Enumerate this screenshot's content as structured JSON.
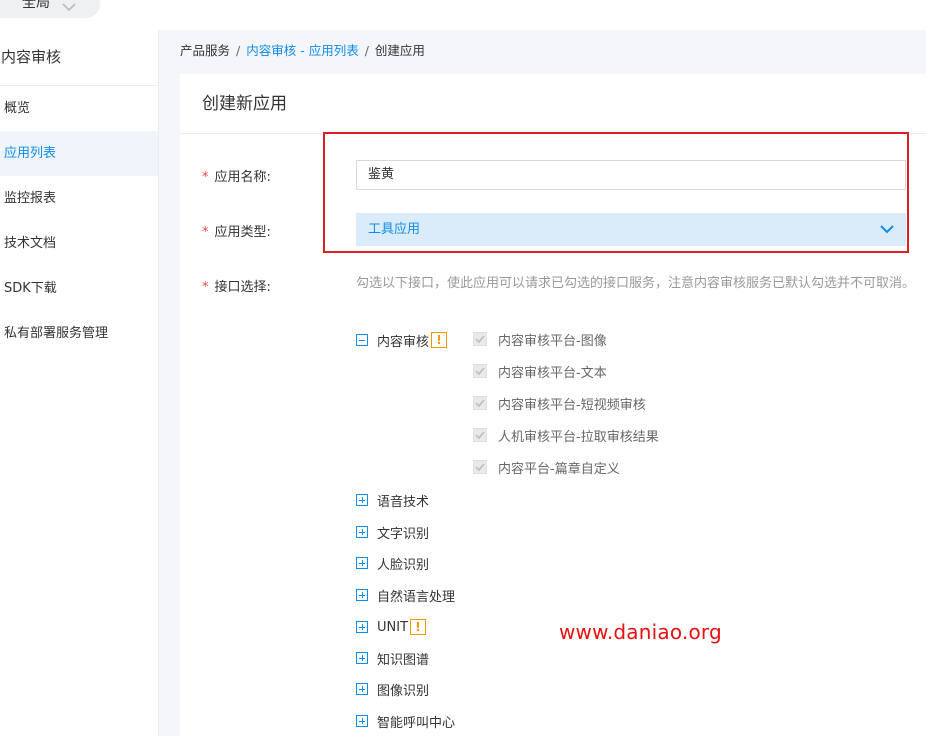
{
  "topbar": {
    "region_label": "全局"
  },
  "sidebar": {
    "title": "内容审核",
    "items": [
      {
        "label": "概览"
      },
      {
        "label": "应用列表",
        "active": true
      },
      {
        "label": "监控报表"
      },
      {
        "label": "技术文档"
      },
      {
        "label": "SDK下载"
      },
      {
        "label": "私有部署服务管理"
      }
    ]
  },
  "breadcrumb": {
    "root": "产品服务",
    "sep": "/",
    "parent": "内容审核 - 应用列表",
    "current": "创建应用"
  },
  "card": {
    "title": "创建新应用"
  },
  "form": {
    "required_mark": "*",
    "name_label": "应用名称:",
    "name_value": "鉴黄",
    "type_label": "应用类型:",
    "type_value": "工具应用",
    "api_label": "接口选择:",
    "api_hint": "勾选以下接口，使此应用可以请求已勾选的接口服务，注意内容审核服务已默认勾选并不可取消。"
  },
  "tree": {
    "expanded_group": {
      "label": "内容审核",
      "warn": "!",
      "children": [
        "内容审核平台-图像",
        "内容审核平台-文本",
        "内容审核平台-短视频审核",
        "人机审核平台-拉取审核结果",
        "内容平台-篇章自定义"
      ]
    },
    "groups": [
      {
        "label": "语音技术"
      },
      {
        "label": "文字识别"
      },
      {
        "label": "人脸识别"
      },
      {
        "label": "自然语言处理"
      },
      {
        "label": "UNIT",
        "warn": "!"
      },
      {
        "label": "知识图谱"
      },
      {
        "label": "图像识别"
      },
      {
        "label": "智能呼叫中心"
      }
    ]
  },
  "watermark": "www.daniao.org",
  "colors": {
    "accent": "#108cee",
    "required": "#e64552",
    "highlight": "#e01e22",
    "warn": "#f39800"
  }
}
